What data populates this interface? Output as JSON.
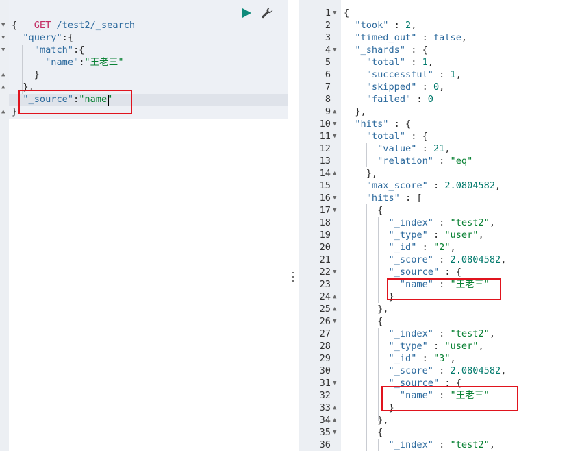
{
  "request": {
    "method": "GET",
    "path": "/test2/_search",
    "lines": [
      "{",
      "  \"query\":{",
      "    \"match\":{",
      "      \"name\":\"王老三\"",
      "    }",
      "  },",
      "  \"_source\":\"name\"",
      "}"
    ]
  },
  "response": {
    "line_numbers": [
      "1",
      "2",
      "3",
      "4",
      "5",
      "6",
      "7",
      "8",
      "9",
      "10",
      "11",
      "12",
      "13",
      "14",
      "15",
      "16",
      "17",
      "18",
      "19",
      "20",
      "21",
      "22",
      "23",
      "24",
      "25",
      "26",
      "27",
      "28",
      "29",
      "30",
      "31",
      "32",
      "33",
      "34",
      "35",
      "36"
    ],
    "lines": [
      "{",
      "  \"took\" : 2,",
      "  \"timed_out\" : false,",
      "  \"_shards\" : {",
      "    \"total\" : 1,",
      "    \"successful\" : 1,",
      "    \"skipped\" : 0,",
      "    \"failed\" : 0",
      "  },",
      "  \"hits\" : {",
      "    \"total\" : {",
      "      \"value\" : 21,",
      "      \"relation\" : \"eq\"",
      "    },",
      "    \"max_score\" : 2.0804582,",
      "    \"hits\" : [",
      "      {",
      "        \"_index\" : \"test2\",",
      "        \"_type\" : \"user\",",
      "        \"_id\" : \"2\",",
      "        \"_score\" : 2.0804582,",
      "        \"_source\" : {",
      "          \"name\" : \"王老三\"",
      "        }",
      "      },",
      "      {",
      "        \"_index\" : \"test2\",",
      "        \"_type\" : \"user\",",
      "        \"_id\" : \"3\",",
      "        \"_score\" : 2.0804582,",
      "        \"_source\" : {",
      "          \"name\" : \"王老三\"",
      "        }",
      "      },",
      "      {",
      "        \"_index\" : \"test2\","
    ]
  },
  "icons": {
    "run": "play-icon",
    "settings": "wrench-icon",
    "splitter": "vertical-dots-icon"
  },
  "colors": {
    "method": "#c32d62",
    "key": "#2e6b9e",
    "string": "#0b8235",
    "number": "#00796b",
    "run_icon": "#0e8a7a",
    "highlight_box": "#e0141e",
    "gutter": "#eceff3",
    "request_background": "#edf0f5"
  }
}
